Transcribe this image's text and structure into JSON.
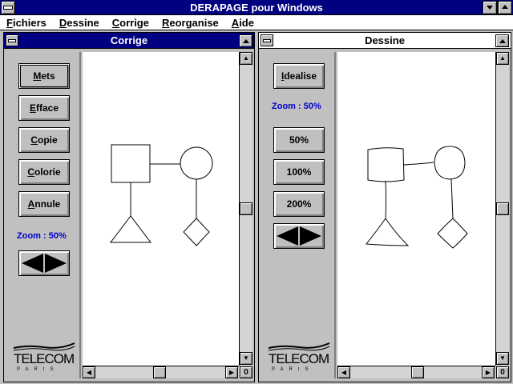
{
  "app": {
    "title": "DERAPAGE pour Windows"
  },
  "menu": {
    "items": [
      "Fichiers",
      "Dessine",
      "Corrige",
      "Reorganise",
      "Aide"
    ]
  },
  "left_window": {
    "title": "Corrige",
    "buttons": [
      "Mets",
      "Efface",
      "Copie",
      "Colorie",
      "Annule"
    ],
    "zoom_label": "Zoom : 50%",
    "logo_text": "TELECOM",
    "logo_sub": "PARIS"
  },
  "right_window": {
    "title": "Dessine",
    "buttons": [
      "Idealise"
    ],
    "zoom_label": "Zoom : 50%",
    "zoom_buttons": [
      "50%",
      "100%",
      "200%"
    ],
    "logo_text": "TELECOM",
    "logo_sub": "PARIS"
  },
  "colors": {
    "active_title": "#000080",
    "zoom_text": "#0000cc",
    "panel": "#c0c0c0"
  },
  "icons": {
    "scroll_corner_label": "0"
  }
}
